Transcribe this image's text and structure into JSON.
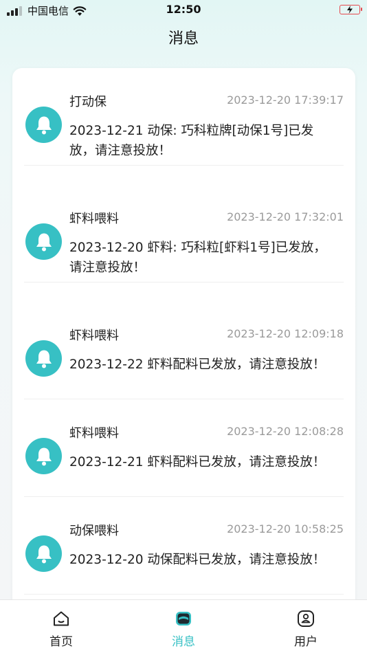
{
  "status_bar": {
    "carrier": "中国电信",
    "time": "12:50"
  },
  "header": {
    "title": "消息"
  },
  "messages": [
    {
      "title": "打动保",
      "time": "2023-12-20 17:39:17",
      "body": "2023-12-21 动保: 巧科粒牌[动保1号]已发放，请注意投放！"
    },
    {
      "title": "虾料喂料",
      "time": "2023-12-20 17:32:01",
      "body": "2023-12-20 虾料: 巧科粒[虾料1号]已发放，请注意投放！"
    },
    {
      "title": "虾料喂料",
      "time": "2023-12-20 12:09:18",
      "body": "2023-12-22 虾料配料已发放，请注意投放！"
    },
    {
      "title": "虾料喂料",
      "time": "2023-12-20 12:08:28",
      "body": "2023-12-21 虾料配料已发放，请注意投放！"
    },
    {
      "title": "动保喂料",
      "time": "2023-12-20 10:58:25",
      "body": "2023-12-20 动保配料已发放，请注意投放！"
    }
  ],
  "tabbar": {
    "items": [
      {
        "label": "首页",
        "icon": "home-icon",
        "active": false
      },
      {
        "label": "消息",
        "icon": "message-icon",
        "active": true
      },
      {
        "label": "用户",
        "icon": "user-icon",
        "active": false
      }
    ]
  },
  "colors": {
    "accent": "#37c0c4",
    "battery": "#e5484d"
  }
}
